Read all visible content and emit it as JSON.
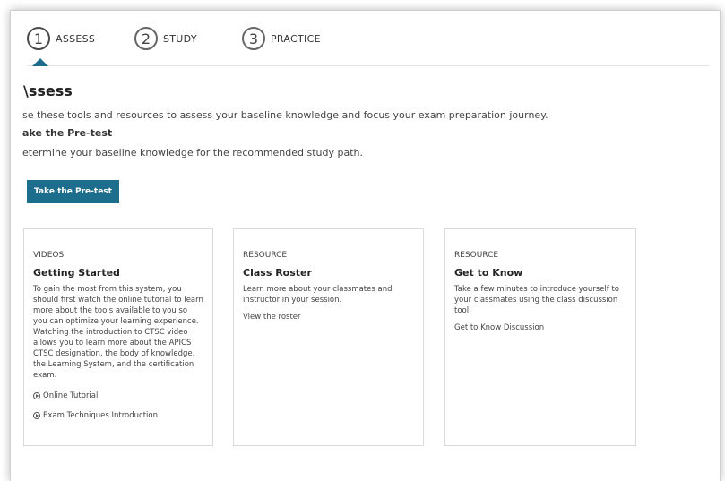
{
  "steps": [
    {
      "number": "1",
      "label": "ASSESS"
    },
    {
      "number": "2",
      "label": "STUDY"
    },
    {
      "number": "3",
      "label": "PRACTICE"
    }
  ],
  "section": {
    "title": "\\ssess",
    "intro": "se these tools and resources to assess your baseline knowledge and focus your exam preparation journey.",
    "subhead": "ake the Pre-test",
    "subdesc": "etermine your baseline knowledge for the recommended study path.",
    "button_label": "Take the Pre-test"
  },
  "cards": [
    {
      "category": "VIDEOS",
      "title": "Getting Started",
      "description": "To gain the most from this system, you should first watch the online tutorial to learn more about the tools available to you so you can optimize your learning experience. Watching the introduction to CTSC video allows you to learn more about the APICS CTSC designation, the body of knowledge, the Learning System, and the certification exam.",
      "links": [
        "Online Tutorial",
        "Exam Techniques Introduction"
      ]
    },
    {
      "category": "RESOURCE",
      "title": "Class Roster",
      "description": "Learn more about your classmates and instructor in your session.",
      "link": "View the roster"
    },
    {
      "category": "RESOURCE",
      "title": "Get to Know",
      "description": "Take a few minutes to introduce yourself to your classmates using the class discussion tool.",
      "link": "Get to Know Discussion"
    }
  ],
  "colors": {
    "accent": "#1d6d8c"
  }
}
